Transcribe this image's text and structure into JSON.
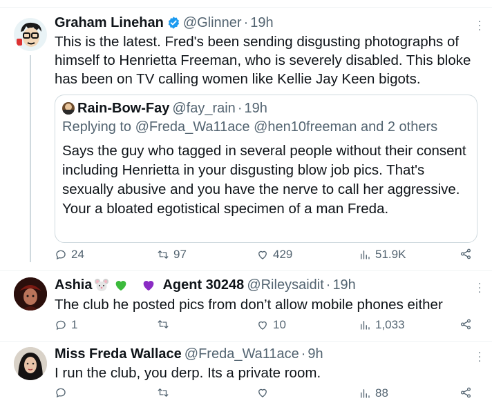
{
  "colors": {
    "text": "#0f1419",
    "secondary": "#536471",
    "verified": "#1d9bf0",
    "border": "#cfd9de"
  },
  "tweets": [
    {
      "name": "Graham Linehan",
      "handle": "@Glinner",
      "time": "19h",
      "verified": true,
      "text": "This is the latest. Fred's been sending disgusting photographs of himself to Henrietta Freeman, who is severely disabled. This bloke has been on TV calling women like Kellie Jay Keen bigots.",
      "quote": {
        "name": "Rain-Bow-Fay",
        "handle": "@fay_rain",
        "time": "19h",
        "replying": "Replying to @Freda_Wa11ace @hen10freeman and 2 others",
        "text": "Says the guy who tagged in several people without their consent including Henrietta in your disgusting blow job pics. That's sexually abusive and you have the nerve to call her aggressive. Your a bloated egotistical specimen of a man Freda."
      },
      "stats": {
        "replies": "24",
        "retweets": "97",
        "likes": "429",
        "views": "51.9K"
      }
    },
    {
      "name": "Ashia",
      "name_emojis": [
        "mouse-face-icon",
        "green-heart-icon",
        "purple-heart-icon"
      ],
      "name_suffix": "Agent 30248",
      "handle": "@Rileysaidit",
      "time": "19h",
      "text": "The club he posted pics from don’t allow mobile phones either",
      "stats": {
        "replies": "1",
        "retweets": "",
        "likes": "10",
        "views": "1,033"
      }
    },
    {
      "name": "Miss Freda Wallace",
      "handle": "@Freda_Wa11ace",
      "time": "9h",
      "text": "I run the club, you derp. Its a private room.",
      "stats": {
        "replies": "",
        "retweets": "",
        "likes": "",
        "views": "88"
      }
    }
  ],
  "separator": "·"
}
